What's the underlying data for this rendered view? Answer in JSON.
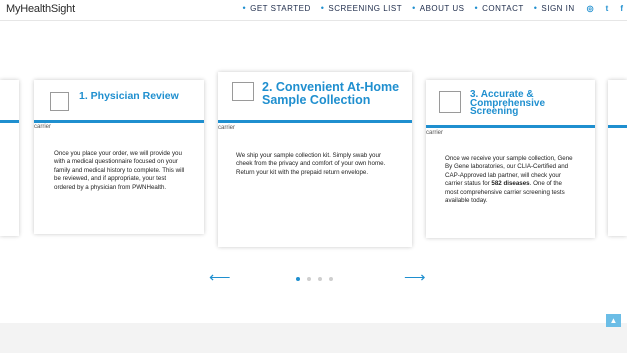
{
  "header": {
    "logo": "MyHealthSight",
    "nav": [
      {
        "label": "GET STARTED"
      },
      {
        "label": "SCREENING LIST"
      },
      {
        "label": "ABOUT US"
      },
      {
        "label": "CONTACT"
      },
      {
        "label": "SIGN IN"
      }
    ],
    "social": {
      "instagram_glyph": "◎",
      "twitter_glyph": "t",
      "facebook_glyph": "f"
    }
  },
  "cards": [
    {
      "title": "1. Physician Review",
      "image_alt": "carrier",
      "body": "Once you place your order, we will provide you with a medical questionnaire focused on your family and medical history to complete. This will be reviewed, and if appropriate, your test ordered by a physician from PWNHealth."
    },
    {
      "title": "2. Convenient At-Home Sample Collection",
      "image_alt": "carrier",
      "body": "We ship your sample collection kit. Simply swab your cheek from the privacy and comfort of your own home. Return your kit with the prepaid return envelope."
    },
    {
      "title": "3. Accurate & Comprehensive Screening",
      "image_alt": "carrier",
      "body_pre": "Once we receive your sample collection, Gene By Gene laboratories, our CLIA-Certified and CAP-Approved lab partner, will check your carrier status for ",
      "body_bold": "582 diseases",
      "body_post": ". One of the most comprehensive carrier screening tests available today."
    }
  ],
  "carousel": {
    "prev_glyph": "⟵",
    "next_glyph": "⟶",
    "dots": 4,
    "active_dot": 0
  },
  "scroll_top_glyph": "▲",
  "colors": {
    "accent": "#1f8fcf",
    "nav_text": "#1d2b4a",
    "footer_band": "#f3f3f3"
  }
}
